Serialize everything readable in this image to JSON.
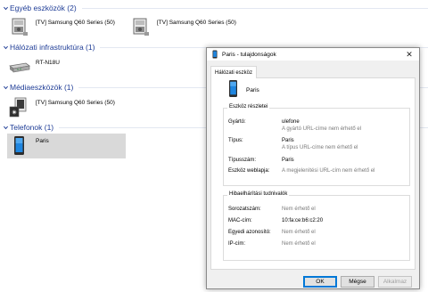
{
  "groups": [
    {
      "title": "Egyéb eszközök (2)"
    },
    {
      "title": "Hálózati infrastruktúra (1)"
    },
    {
      "title": "Médiaeszközök (1)"
    },
    {
      "title": "Telefonok (1)"
    }
  ],
  "devices": {
    "other_1": "[TV] Samsung Q60 Series (50)",
    "other_2": "[TV] Samsung Q60 Series (50)",
    "router": "RT-N18U",
    "media": "[TV] Samsung Q60 Series (50)",
    "phone": "Paris"
  },
  "dialog": {
    "title": "Paris - tulajdonságok",
    "close_glyph": "✕",
    "tab": "Hálózati eszköz",
    "device_name": "Paris",
    "details_title": "Eszköz részletei",
    "details": {
      "manufacturer_label": "Gyártó:",
      "manufacturer_value": "ulefone",
      "manufacturer_note": "A gyártó URL-címe nem érhető el",
      "type_label": "Típus:",
      "type_value": "Paris",
      "type_note": "A típus URL-címe nem érhető el",
      "model_label": "Típusszám:",
      "model_value": "Paris",
      "web_label": "Eszköz weblapja:",
      "web_value": "A megjelenítési URL-cím nem érhető el"
    },
    "troubleshoot_title": "Hibaelhárítási tudnivalók",
    "troubleshoot": {
      "serial_label": "Sorozatszám:",
      "serial_value": "Nem érhető el",
      "mac_label": "MAC-cím:",
      "mac_value": "10:fa:ce:b6:c2:20",
      "uid_label": "Egyedi azonosító:",
      "uid_value": "Nem érhető el",
      "ip_label": "IP-cím:",
      "ip_value": "Nem érhető el"
    },
    "buttons": {
      "ok": "OK",
      "cancel": "Mégse",
      "apply": "Alkalmaz"
    }
  },
  "colors": {
    "group_header": "#1e3c96",
    "selection": "#d9d9d9",
    "accent": "#0078d7"
  }
}
